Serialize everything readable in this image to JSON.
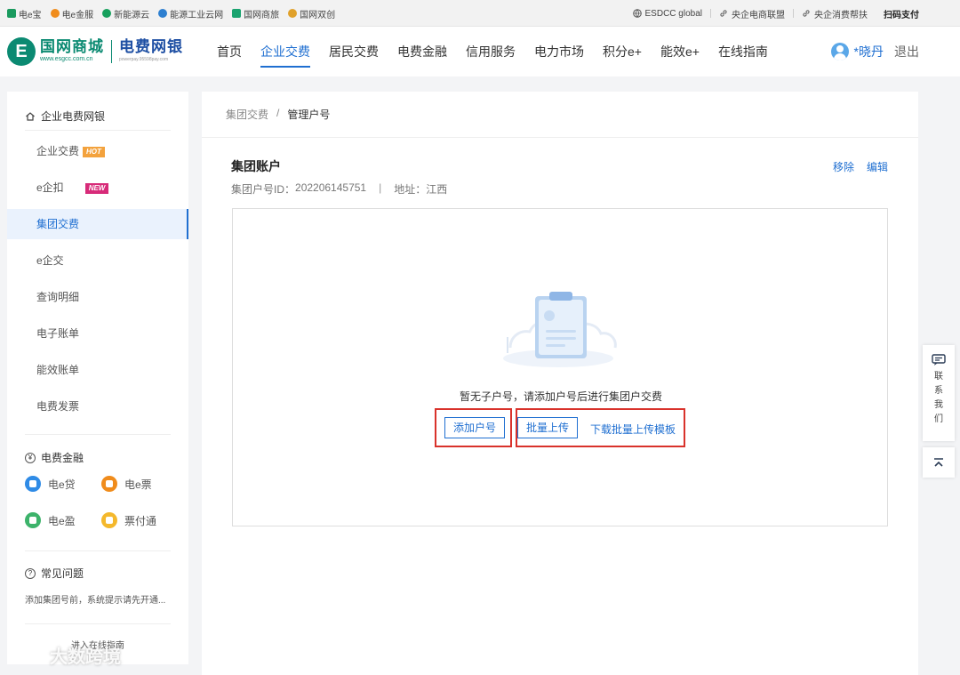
{
  "topbar": {
    "links": [
      {
        "label": "电e宝",
        "color": "#1a9a5e"
      },
      {
        "label": "电e金服",
        "color": "#f08c1c"
      },
      {
        "label": "新能源云",
        "color": "#17a05d"
      },
      {
        "label": "能源工业云网",
        "color": "#2d7fd0"
      },
      {
        "label": "国网商旅",
        "color": "#1aa36f"
      },
      {
        "label": "国网双创",
        "color": "#e0a12b"
      }
    ],
    "right_links": [
      "ESDCC global",
      "央企电商联盟",
      "央企消费帮扶"
    ],
    "scan_pay": "扫码支付"
  },
  "header": {
    "logo_name": "国网商城",
    "logo_url": "www.esgcc.com.cn",
    "logo_name2": "电费网银",
    "logo_url2": "powerpay.95598pay.com",
    "nav": [
      "首页",
      "企业交费",
      "居民交费",
      "电费金融",
      "信用服务",
      "电力市场",
      "积分e+",
      "能效e+",
      "在线指南"
    ],
    "active_nav": "企业交费",
    "user_name": "*晓丹",
    "logout": "退出"
  },
  "sidebar": {
    "section1_title": "企业电费网银",
    "items": [
      {
        "label": "企业交费",
        "badge": "HOT"
      },
      {
        "label": "e企扣",
        "badge": "NEW"
      },
      {
        "label": "集团交费",
        "badge": ""
      },
      {
        "label": "e企交",
        "badge": ""
      },
      {
        "label": "查询明细",
        "badge": ""
      },
      {
        "label": "电子账单",
        "badge": ""
      },
      {
        "label": "能效账单",
        "badge": ""
      },
      {
        "label": "电费发票",
        "badge": ""
      }
    ],
    "active_item": "集团交费",
    "section2_title": "电费金融",
    "fin_items": [
      {
        "label": "电e贷",
        "color": "#2f8be6"
      },
      {
        "label": "电e票",
        "color": "#f08c1c"
      },
      {
        "label": "电e盈",
        "color": "#3db36b"
      },
      {
        "label": "票付通",
        "color": "#f4b82c"
      }
    ],
    "section3_title": "常见问题",
    "faq_text": "添加集团号前，系统提示请先开通...",
    "guide_link": "进入在线指南"
  },
  "main": {
    "breadcrumb": [
      "集团交费",
      "管理户号"
    ],
    "group_title": "集团账户",
    "actions": [
      "移除",
      "编辑"
    ],
    "group_id_label": "集团户号ID：",
    "group_id": "202206145751",
    "address_label": "地址：",
    "address": "江西",
    "empty_text": "暂无子户号，请添加户号后进行集团户交费",
    "btn_add": "添加户号",
    "btn_batch": "批量上传",
    "link_template": "下载批量上传模板"
  },
  "float": {
    "contact": [
      "联",
      "系",
      "我",
      "们"
    ]
  },
  "watermark": "大数跨境"
}
